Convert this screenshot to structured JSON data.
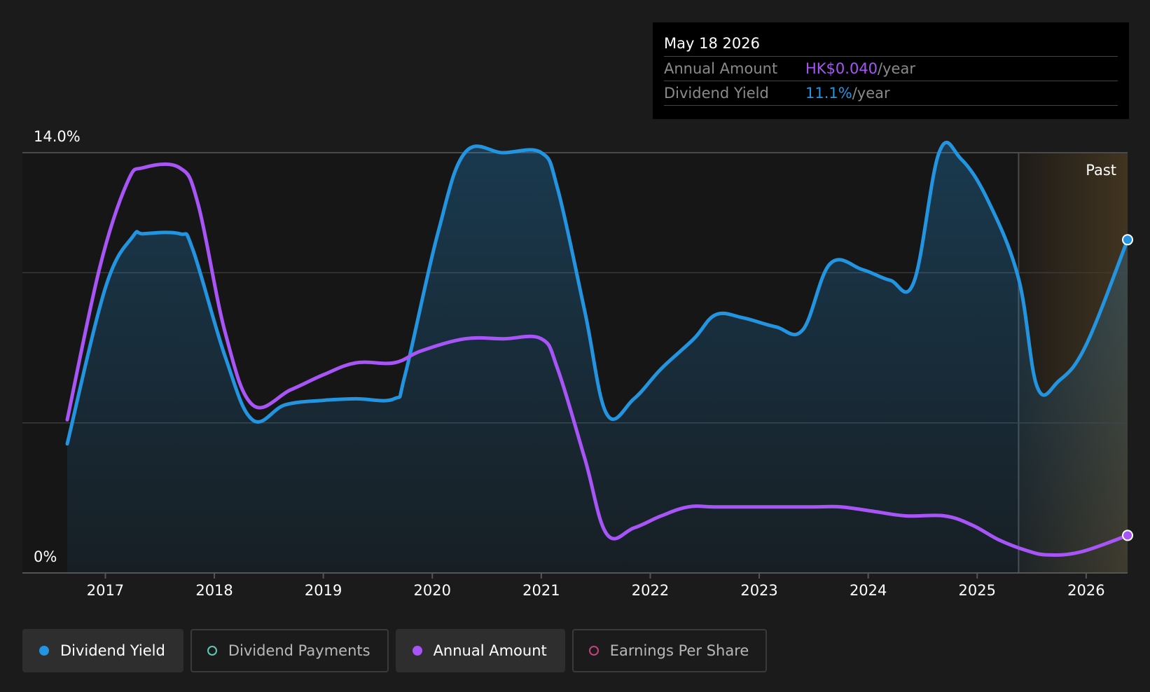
{
  "tooltip": {
    "date": "May 18 2026",
    "annual_label": "Annual Amount",
    "annual_value": "HK$0.040",
    "annual_unit": "/year",
    "yield_label": "Dividend Yield",
    "yield_value": "11.1%",
    "yield_unit": "/year"
  },
  "past_label": "Past",
  "legend": [
    {
      "label": "Dividend Yield",
      "color": "#2394e0",
      "active": true
    },
    {
      "label": "Dividend Payments",
      "color": "#5cc9b5",
      "active": false
    },
    {
      "label": "Annual Amount",
      "color": "#a855f7",
      "active": true
    },
    {
      "label": "Earnings Per Share",
      "color": "#c2447e",
      "active": false
    }
  ],
  "colors": {
    "yield": "#2394e0",
    "annual": "#a855f7",
    "grid": "#3a3a3a",
    "axis": "#555555",
    "forecast": "#b0823a"
  },
  "chart_data": {
    "type": "line",
    "y_axis": {
      "top_label": "14.0%",
      "bottom_label": "0%",
      "min": 0,
      "max": 14.0,
      "gridlines": [
        0,
        5,
        10,
        14
      ]
    },
    "x_axis": {
      "ticks": [
        "2017",
        "2018",
        "2019",
        "2020",
        "2021",
        "2022",
        "2023",
        "2024",
        "2025",
        "2026"
      ],
      "min": 2016.65,
      "max": 2026.38
    },
    "past_region_start": 2025.38,
    "series": [
      {
        "name": "Dividend Yield",
        "unit": "%",
        "points": [
          [
            2016.65,
            4.3
          ],
          [
            2017.0,
            9.5
          ],
          [
            2017.25,
            11.2
          ],
          [
            2017.35,
            11.3
          ],
          [
            2017.68,
            11.3
          ],
          [
            2017.8,
            10.8
          ],
          [
            2018.1,
            7.2
          ],
          [
            2018.35,
            5.1
          ],
          [
            2018.65,
            5.6
          ],
          [
            2019.0,
            5.75
          ],
          [
            2019.3,
            5.8
          ],
          [
            2019.65,
            5.8
          ],
          [
            2019.75,
            6.6
          ],
          [
            2020.05,
            11.3
          ],
          [
            2020.3,
            14.0
          ],
          [
            2020.65,
            14.0
          ],
          [
            2021.0,
            14.0
          ],
          [
            2021.15,
            12.8
          ],
          [
            2021.4,
            8.7
          ],
          [
            2021.6,
            5.3
          ],
          [
            2021.85,
            5.8
          ],
          [
            2022.1,
            6.8
          ],
          [
            2022.4,
            7.8
          ],
          [
            2022.6,
            8.6
          ],
          [
            2022.85,
            8.5
          ],
          [
            2023.15,
            8.2
          ],
          [
            2023.4,
            8.1
          ],
          [
            2023.65,
            10.3
          ],
          [
            2023.95,
            10.1
          ],
          [
            2024.2,
            9.75
          ],
          [
            2024.42,
            9.7
          ],
          [
            2024.65,
            14.0
          ],
          [
            2024.85,
            13.8
          ],
          [
            2025.1,
            12.4
          ],
          [
            2025.38,
            9.8
          ],
          [
            2025.55,
            6.2
          ],
          [
            2025.75,
            6.4
          ],
          [
            2026.0,
            7.6
          ],
          [
            2026.38,
            11.1
          ]
        ]
      },
      {
        "name": "Annual Amount",
        "unit": "HK$",
        "points": [
          [
            2016.65,
            5.1
          ],
          [
            2016.95,
            10.2
          ],
          [
            2017.2,
            13.0
          ],
          [
            2017.35,
            13.5
          ],
          [
            2017.68,
            13.5
          ],
          [
            2017.85,
            12.3
          ],
          [
            2018.1,
            8.0
          ],
          [
            2018.35,
            5.6
          ],
          [
            2018.7,
            6.1
          ],
          [
            2019.0,
            6.6
          ],
          [
            2019.3,
            7.0
          ],
          [
            2019.65,
            7.0
          ],
          [
            2019.9,
            7.4
          ],
          [
            2020.3,
            7.8
          ],
          [
            2020.65,
            7.8
          ],
          [
            2021.0,
            7.8
          ],
          [
            2021.15,
            6.8
          ],
          [
            2021.4,
            3.8
          ],
          [
            2021.6,
            1.3
          ],
          [
            2021.85,
            1.5
          ],
          [
            2022.1,
            1.9
          ],
          [
            2022.35,
            2.2
          ],
          [
            2022.6,
            2.2
          ],
          [
            2023.0,
            2.2
          ],
          [
            2023.5,
            2.2
          ],
          [
            2023.75,
            2.2
          ],
          [
            2024.05,
            2.05
          ],
          [
            2024.35,
            1.9
          ],
          [
            2024.7,
            1.9
          ],
          [
            2024.95,
            1.6
          ],
          [
            2025.2,
            1.1
          ],
          [
            2025.45,
            0.75
          ],
          [
            2025.65,
            0.6
          ],
          [
            2025.95,
            0.7
          ],
          [
            2026.38,
            1.25
          ]
        ]
      }
    ]
  }
}
